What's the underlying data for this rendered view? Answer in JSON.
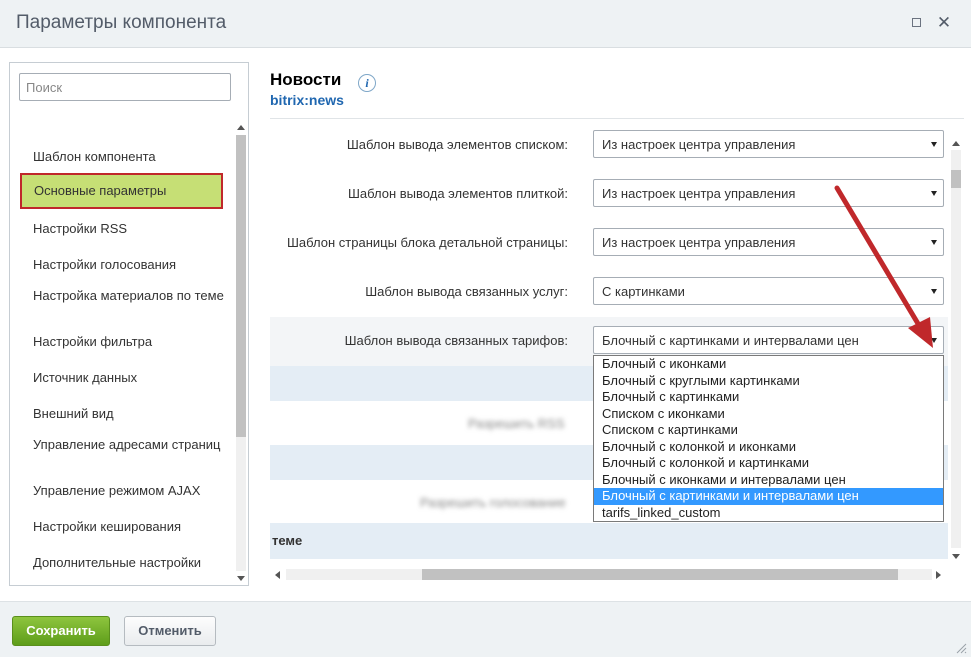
{
  "window": {
    "title": "Параметры компонента",
    "maximize_icon": "maximize-icon",
    "close_icon": "close-icon",
    "close_glyph": "✕"
  },
  "sidebar": {
    "search_placeholder": "Поиск",
    "items": [
      {
        "label": "Шаблон компонента",
        "active": false
      },
      {
        "label": "Основные параметры",
        "active": true
      },
      {
        "label": "Настройки RSS",
        "active": false
      },
      {
        "label": "Настройки голосования",
        "active": false
      },
      {
        "label": "Настройка материалов по теме",
        "active": false
      },
      {
        "label": "Настройки фильтра",
        "active": false
      },
      {
        "label": "Источник данных",
        "active": false
      },
      {
        "label": "Внешний вид",
        "active": false
      },
      {
        "label": "Управление адресами страниц",
        "active": false
      },
      {
        "label": "Управление режимом AJAX",
        "active": false
      },
      {
        "label": "Настройки кеширования",
        "active": false
      },
      {
        "label": "Дополнительные настройки",
        "active": false
      }
    ]
  },
  "component": {
    "name": "Новости",
    "info_glyph": "i",
    "code": "bitrix:news"
  },
  "params": [
    {
      "label": "Шаблон вывода элементов списком:",
      "value": "Из настроек центра управления"
    },
    {
      "label": "Шаблон вывода элементов плиткой:",
      "value": "Из настроек центра управления"
    },
    {
      "label": "Шаблон страницы блока детальной страницы:",
      "value": "Из настроек центра управления"
    },
    {
      "label": "Шаблон вывода связанных услуг:",
      "value": "С картинками"
    },
    {
      "label": "Шаблон вывода связанных тарифов:",
      "value": "Блочный с картинками и интервалами цен"
    }
  ],
  "hidden_rows": [
    {
      "label": "Разрешить RSS"
    },
    {
      "label": "Разрешить голосование"
    }
  ],
  "section_heading": "теме",
  "dropdown": {
    "options": [
      "Блочный с иконками",
      "Блочный с круглыми картинками",
      "Блочный с картинками",
      "Списком с иконками",
      "Списком с картинками",
      "Блочный с колонкой и иконками",
      "Блочный с колонкой и картинками",
      "Блочный с иконками и интервалами цен",
      "Блочный с картинками и интервалами цен",
      "tarifs_linked_custom"
    ],
    "selected_index": 8
  },
  "footer": {
    "save_label": "Сохранить",
    "cancel_label": "Отменить"
  },
  "colors": {
    "active_item_bg": "#c6df75",
    "active_item_border": "#c0282b",
    "annotation_arrow": "#c0282b",
    "selected_option_bg": "#3399ff",
    "save_button": "#6aa823",
    "link_blue": "#2067b0"
  }
}
